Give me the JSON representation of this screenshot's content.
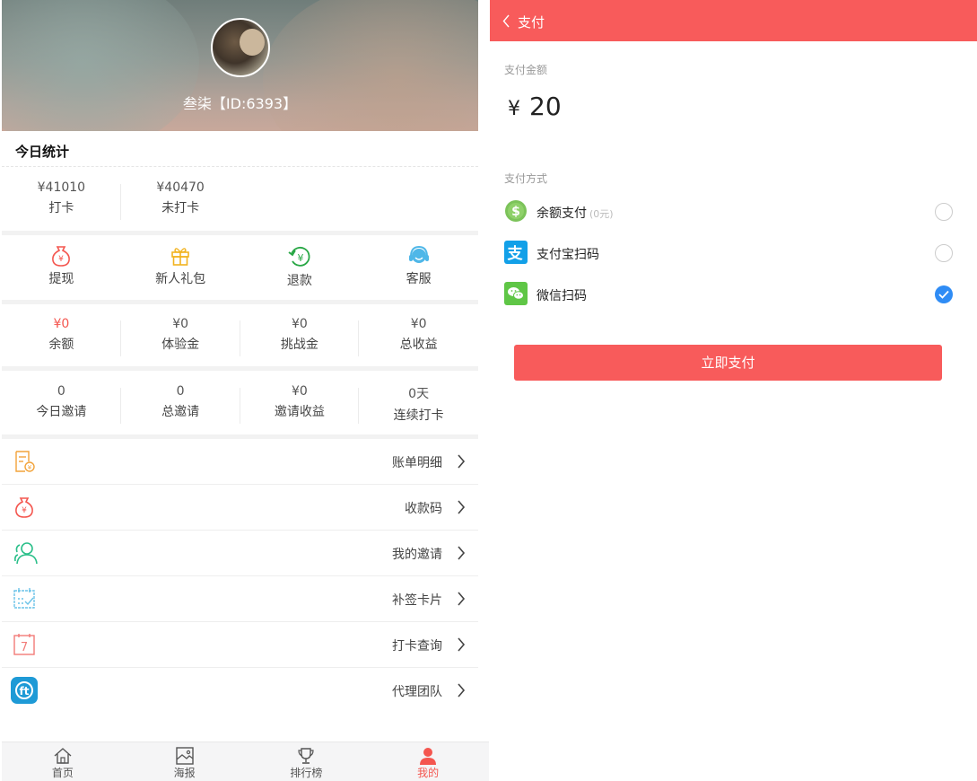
{
  "profile": {
    "name": "叁柒【ID:6393】"
  },
  "today_stats": {
    "title": "今日统计",
    "items": [
      {
        "value": "¥41010",
        "label": "打卡"
      },
      {
        "value": "¥40470",
        "label": "未打卡"
      }
    ]
  },
  "quick_actions": [
    {
      "label": "提现",
      "icon": "money-bag-icon"
    },
    {
      "label": "新人礼包",
      "icon": "gift-icon"
    },
    {
      "label": "退款",
      "icon": "refund-icon"
    },
    {
      "label": "客服",
      "icon": "headset-icon"
    }
  ],
  "balance": [
    {
      "value": "¥0",
      "label": "余额"
    },
    {
      "value": "¥0",
      "label": "体验金"
    },
    {
      "value": "¥0",
      "label": "挑战金"
    },
    {
      "value": "¥0",
      "label": "总收益"
    }
  ],
  "invite": [
    {
      "value": "0",
      "label": "今日邀请"
    },
    {
      "value": "0",
      "label": "总邀请"
    },
    {
      "value": "¥0",
      "label": "邀请收益"
    },
    {
      "value": "0天",
      "label": "连续打卡"
    }
  ],
  "menu": [
    {
      "label": "账单明细",
      "icon": "bill-icon"
    },
    {
      "label": "收款码",
      "icon": "money-bag-icon"
    },
    {
      "label": "我的邀请",
      "icon": "users-icon"
    },
    {
      "label": "补签卡片",
      "icon": "calendar-check-icon"
    },
    {
      "label": "打卡查询",
      "icon": "calendar-icon"
    },
    {
      "label": "代理团队",
      "icon": "agent-team-icon"
    }
  ],
  "tabbar": [
    {
      "label": "首页",
      "icon": "home-icon"
    },
    {
      "label": "海报",
      "icon": "image-icon"
    },
    {
      "label": "排行榜",
      "icon": "trophy-icon"
    },
    {
      "label": "我的",
      "icon": "user-icon",
      "active": true
    }
  ],
  "payment": {
    "title": "支付",
    "amount_label": "支付金额",
    "currency": "¥",
    "amount": "20",
    "method_label": "支付方式",
    "methods": [
      {
        "label": "余额支付",
        "note": "(0元)",
        "icon": "balance-coin-icon",
        "checked": false
      },
      {
        "label": "支付宝扫码",
        "icon": "alipay-icon",
        "checked": false
      },
      {
        "label": "微信扫码",
        "icon": "wechat-icon",
        "checked": true
      }
    ],
    "submit_label": "立即支付"
  },
  "colors": {
    "accent": "#f85b5b",
    "check": "#2f8cf5"
  }
}
